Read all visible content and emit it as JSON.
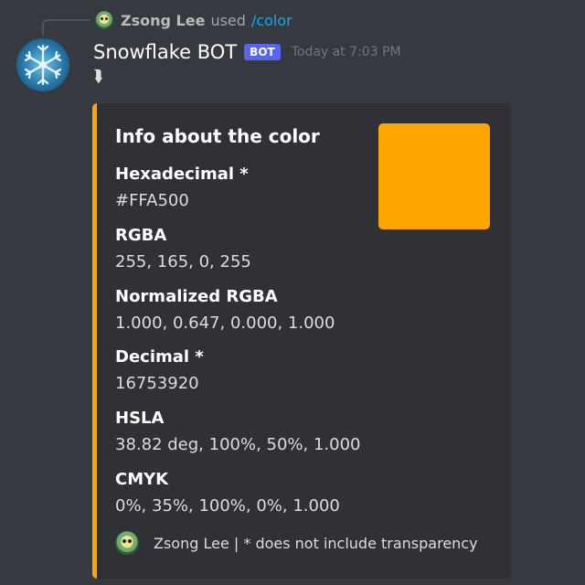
{
  "reply": {
    "username": "Zsong Lee",
    "used_text": "used",
    "command": "/color"
  },
  "message": {
    "author": "Snowflake BOT",
    "badge": "BOT",
    "timestamp": "Today at 7:03 PM",
    "content": "⮯"
  },
  "embed": {
    "accent_color": "#ffa500",
    "title": "Info about the color",
    "thumbnail_color": "#ffa500",
    "fields": [
      {
        "name": "Hexadecimal *",
        "value": "#FFA500"
      },
      {
        "name": "RGBA",
        "value": "255, 165, 0, 255"
      },
      {
        "name": "Normalized RGBA",
        "value": "1.000, 0.647, 0.000, 1.000"
      },
      {
        "name": "Decimal *",
        "value": "16753920"
      },
      {
        "name": "HSLA",
        "value": "38.82 deg, 100%, 50%, 1.000"
      },
      {
        "name": "CMYK",
        "value": "0%, 35%, 100%, 0%, 1.000"
      }
    ],
    "footer": "Zsong Lee | * does not include transparency"
  },
  "icons": {
    "reply_avatar": "user-avatar-icon",
    "bot_avatar": "snowflake-avatar-icon",
    "footer_avatar": "user-avatar-icon"
  },
  "colors": {
    "background": "#36393f",
    "embed_background": "#2f3136",
    "bot_badge": "#5865f2",
    "command_link": "#00aff4"
  }
}
